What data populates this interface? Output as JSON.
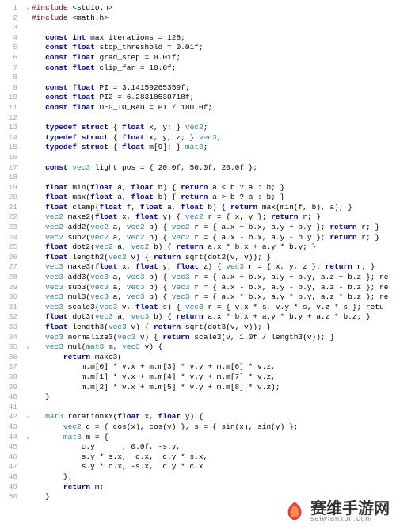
{
  "watermark": {
    "text": "赛维手游网",
    "sub": "saiwianxun.com"
  },
  "code": [
    {
      "n": 1,
      "fold": "v",
      "segs": [
        [
          "pp",
          "#include "
        ],
        [
          "nm",
          "<stdio.h>"
        ]
      ]
    },
    {
      "n": 2,
      "fold": "|",
      "segs": [
        [
          "pp",
          "#include "
        ],
        [
          "nm",
          "<math.h>"
        ]
      ]
    },
    {
      "n": 3,
      "fold": "",
      "segs": []
    },
    {
      "n": 4,
      "fold": "",
      "segs": [
        [
          "nm",
          "   "
        ],
        [
          "kw",
          "const int"
        ],
        [
          "nm",
          " max_iterations = 128;"
        ]
      ]
    },
    {
      "n": 5,
      "fold": "",
      "segs": [
        [
          "nm",
          "   "
        ],
        [
          "kw",
          "const float"
        ],
        [
          "nm",
          " stop_threshold = 0.01f;"
        ]
      ]
    },
    {
      "n": 6,
      "fold": "",
      "segs": [
        [
          "nm",
          "   "
        ],
        [
          "kw",
          "const float"
        ],
        [
          "nm",
          " grad_step = 0.01f;"
        ]
      ]
    },
    {
      "n": 7,
      "fold": "",
      "segs": [
        [
          "nm",
          "   "
        ],
        [
          "kw",
          "const float"
        ],
        [
          "nm",
          " clip_far = 10.0f;"
        ]
      ]
    },
    {
      "n": 8,
      "fold": "",
      "segs": []
    },
    {
      "n": 9,
      "fold": "",
      "segs": [
        [
          "nm",
          "   "
        ],
        [
          "kw",
          "const float"
        ],
        [
          "nm",
          " PI = 3.14159265359f;"
        ]
      ]
    },
    {
      "n": 10,
      "fold": "",
      "segs": [
        [
          "nm",
          "   "
        ],
        [
          "kw",
          "const float"
        ],
        [
          "nm",
          " PI2 = 6.28318530718f;"
        ]
      ]
    },
    {
      "n": 11,
      "fold": "",
      "segs": [
        [
          "nm",
          "   "
        ],
        [
          "kw",
          "const float"
        ],
        [
          "nm",
          " DEG_TO_RAD = PI / 180.0f;"
        ]
      ]
    },
    {
      "n": 12,
      "fold": "",
      "segs": []
    },
    {
      "n": 13,
      "fold": "",
      "segs": [
        [
          "nm",
          "   "
        ],
        [
          "kw",
          "typedef struct"
        ],
        [
          "nm",
          " { "
        ],
        [
          "kw",
          "float"
        ],
        [
          "nm",
          " x, y; } "
        ],
        [
          "ty",
          "vec2"
        ],
        [
          "nm",
          ";"
        ]
      ]
    },
    {
      "n": 14,
      "fold": "",
      "segs": [
        [
          "nm",
          "   "
        ],
        [
          "kw",
          "typedef struct"
        ],
        [
          "nm",
          " { "
        ],
        [
          "kw",
          "float"
        ],
        [
          "nm",
          " x, y, z; } "
        ],
        [
          "ty",
          "vec3"
        ],
        [
          "nm",
          ";"
        ]
      ]
    },
    {
      "n": 15,
      "fold": "",
      "segs": [
        [
          "nm",
          "   "
        ],
        [
          "kw",
          "typedef struct"
        ],
        [
          "nm",
          " { "
        ],
        [
          "kw",
          "float"
        ],
        [
          "nm",
          " m[9]; } "
        ],
        [
          "ty",
          "mat3"
        ],
        [
          "nm",
          ";"
        ]
      ]
    },
    {
      "n": 16,
      "fold": "",
      "segs": []
    },
    {
      "n": 17,
      "fold": "",
      "segs": [
        [
          "nm",
          "   "
        ],
        [
          "kw",
          "const"
        ],
        [
          "nm",
          " "
        ],
        [
          "ty",
          "vec3"
        ],
        [
          "nm",
          " light_pos = { 20.0f, 50.0f, 20.0f };"
        ]
      ]
    },
    {
      "n": 18,
      "fold": "",
      "segs": []
    },
    {
      "n": 19,
      "fold": "",
      "segs": [
        [
          "nm",
          "   "
        ],
        [
          "kw",
          "float"
        ],
        [
          "nm",
          " min("
        ],
        [
          "kw",
          "float"
        ],
        [
          "nm",
          " a, "
        ],
        [
          "kw",
          "float"
        ],
        [
          "nm",
          " b) { "
        ],
        [
          "kw",
          "return"
        ],
        [
          "nm",
          " a < b ? a : b; }"
        ]
      ]
    },
    {
      "n": 20,
      "fold": "",
      "segs": [
        [
          "nm",
          "   "
        ],
        [
          "kw",
          "float"
        ],
        [
          "nm",
          " max("
        ],
        [
          "kw",
          "float"
        ],
        [
          "nm",
          " a, "
        ],
        [
          "kw",
          "float"
        ],
        [
          "nm",
          " b) { "
        ],
        [
          "kw",
          "return"
        ],
        [
          "nm",
          " a > b ? a : b; }"
        ]
      ]
    },
    {
      "n": 21,
      "fold": "",
      "segs": [
        [
          "nm",
          "   "
        ],
        [
          "kw",
          "float"
        ],
        [
          "nm",
          " clamp("
        ],
        [
          "kw",
          "float"
        ],
        [
          "nm",
          " f, "
        ],
        [
          "kw",
          "float"
        ],
        [
          "nm",
          " a, "
        ],
        [
          "kw",
          "float"
        ],
        [
          "nm",
          " b) { "
        ],
        [
          "kw",
          "return"
        ],
        [
          "nm",
          " max(min(f, b), a); }"
        ]
      ]
    },
    {
      "n": 22,
      "fold": "",
      "segs": [
        [
          "nm",
          "   "
        ],
        [
          "ty",
          "vec2"
        ],
        [
          "nm",
          " make2("
        ],
        [
          "kw",
          "float"
        ],
        [
          "nm",
          " x, "
        ],
        [
          "kw",
          "float"
        ],
        [
          "nm",
          " y) { "
        ],
        [
          "ty",
          "vec2"
        ],
        [
          "nm",
          " r = { x, y }; "
        ],
        [
          "kw",
          "return"
        ],
        [
          "nm",
          " r; }"
        ]
      ]
    },
    {
      "n": 23,
      "fold": "",
      "segs": [
        [
          "nm",
          "   "
        ],
        [
          "ty",
          "vec2"
        ],
        [
          "nm",
          " add2("
        ],
        [
          "ty",
          "vec2"
        ],
        [
          "nm",
          " a, "
        ],
        [
          "ty",
          "vec2"
        ],
        [
          "nm",
          " b) { "
        ],
        [
          "ty",
          "vec2"
        ],
        [
          "nm",
          " r = { a.x + b.x, a.y + b.y }; "
        ],
        [
          "kw",
          "return"
        ],
        [
          "nm",
          " r; }"
        ]
      ]
    },
    {
      "n": 24,
      "fold": "",
      "segs": [
        [
          "nm",
          "   "
        ],
        [
          "ty",
          "vec2"
        ],
        [
          "nm",
          " sub2("
        ],
        [
          "ty",
          "vec2"
        ],
        [
          "nm",
          " a, "
        ],
        [
          "ty",
          "vec2"
        ],
        [
          "nm",
          " b) { "
        ],
        [
          "ty",
          "vec2"
        ],
        [
          "nm",
          " r = { a.x - b.x, a.y - b.y }; "
        ],
        [
          "kw",
          "return"
        ],
        [
          "nm",
          " r; }"
        ]
      ]
    },
    {
      "n": 25,
      "fold": "",
      "segs": [
        [
          "nm",
          "   "
        ],
        [
          "kw",
          "float"
        ],
        [
          "nm",
          " dot2("
        ],
        [
          "ty",
          "vec2"
        ],
        [
          "nm",
          " a, "
        ],
        [
          "ty",
          "vec2"
        ],
        [
          "nm",
          " b) { "
        ],
        [
          "kw",
          "return"
        ],
        [
          "nm",
          " a.x * b.x + a.y * b.y; }"
        ]
      ]
    },
    {
      "n": 26,
      "fold": "",
      "segs": [
        [
          "nm",
          "   "
        ],
        [
          "kw",
          "float"
        ],
        [
          "nm",
          " length2("
        ],
        [
          "ty",
          "vec2"
        ],
        [
          "nm",
          " v) { "
        ],
        [
          "kw",
          "return"
        ],
        [
          "nm",
          " sqrt(dot2(v, v)); }"
        ]
      ]
    },
    {
      "n": 27,
      "fold": "",
      "segs": [
        [
          "nm",
          "   "
        ],
        [
          "ty",
          "vec3"
        ],
        [
          "nm",
          " make3("
        ],
        [
          "kw",
          "float"
        ],
        [
          "nm",
          " x, "
        ],
        [
          "kw",
          "float"
        ],
        [
          "nm",
          " y, "
        ],
        [
          "kw",
          "float"
        ],
        [
          "nm",
          " z) { "
        ],
        [
          "ty",
          "vec3"
        ],
        [
          "nm",
          " r = { x, y, z }; "
        ],
        [
          "kw",
          "return"
        ],
        [
          "nm",
          " r; }"
        ]
      ]
    },
    {
      "n": 28,
      "fold": "",
      "segs": [
        [
          "nm",
          "   "
        ],
        [
          "ty",
          "vec3"
        ],
        [
          "nm",
          " add3("
        ],
        [
          "ty",
          "vec3"
        ],
        [
          "nm",
          " a, "
        ],
        [
          "ty",
          "vec3"
        ],
        [
          "nm",
          " b) { "
        ],
        [
          "ty",
          "vec3"
        ],
        [
          "nm",
          " r = { a.x + b.x, a.y + b.y, a.z + b.z }; re"
        ]
      ]
    },
    {
      "n": 29,
      "fold": "",
      "segs": [
        [
          "nm",
          "   "
        ],
        [
          "ty",
          "vec3"
        ],
        [
          "nm",
          " sub3("
        ],
        [
          "ty",
          "vec3"
        ],
        [
          "nm",
          " a, "
        ],
        [
          "ty",
          "vec3"
        ],
        [
          "nm",
          " b) { "
        ],
        [
          "ty",
          "vec3"
        ],
        [
          "nm",
          " r = { a.x - b.x, a.y - b.y, a.z - b.z }; re"
        ]
      ]
    },
    {
      "n": 30,
      "fold": "",
      "segs": [
        [
          "nm",
          "   "
        ],
        [
          "ty",
          "vec3"
        ],
        [
          "nm",
          " mul3("
        ],
        [
          "ty",
          "vec3"
        ],
        [
          "nm",
          " a, "
        ],
        [
          "ty",
          "vec3"
        ],
        [
          "nm",
          " b) { "
        ],
        [
          "ty",
          "vec3"
        ],
        [
          "nm",
          " r = { a.x * b.x, a.y * b.y, a.z * b.z }; re"
        ]
      ]
    },
    {
      "n": 31,
      "fold": "",
      "segs": [
        [
          "nm",
          "   "
        ],
        [
          "ty",
          "vec3"
        ],
        [
          "nm",
          " scale3("
        ],
        [
          "ty",
          "vec3"
        ],
        [
          "nm",
          " v, "
        ],
        [
          "kw",
          "float"
        ],
        [
          "nm",
          " s) { "
        ],
        [
          "ty",
          "vec3"
        ],
        [
          "nm",
          " r = { v.x * s, v.y * s, v.z * s }; retu"
        ]
      ]
    },
    {
      "n": 32,
      "fold": "",
      "segs": [
        [
          "nm",
          "   "
        ],
        [
          "kw",
          "float"
        ],
        [
          "nm",
          " dot3("
        ],
        [
          "ty",
          "vec3"
        ],
        [
          "nm",
          " a, "
        ],
        [
          "ty",
          "vec3"
        ],
        [
          "nm",
          " b) { "
        ],
        [
          "kw",
          "return"
        ],
        [
          "nm",
          " a.x * b.x + a.y * b.y + a.z * b.z; }"
        ]
      ]
    },
    {
      "n": 33,
      "fold": "",
      "segs": [
        [
          "nm",
          "   "
        ],
        [
          "kw",
          "float"
        ],
        [
          "nm",
          " length3("
        ],
        [
          "ty",
          "vec3"
        ],
        [
          "nm",
          " v) { "
        ],
        [
          "kw",
          "return"
        ],
        [
          "nm",
          " sqrt(dot3(v, v)); }"
        ]
      ]
    },
    {
      "n": 34,
      "fold": "",
      "segs": [
        [
          "nm",
          "   "
        ],
        [
          "ty",
          "vec3"
        ],
        [
          "nm",
          " normalize3("
        ],
        [
          "ty",
          "vec3"
        ],
        [
          "nm",
          " v) { "
        ],
        [
          "kw",
          "return"
        ],
        [
          "nm",
          " scale3(v, 1.0f / length3(v)); }"
        ]
      ]
    },
    {
      "n": 35,
      "fold": "v",
      "segs": [
        [
          "nm",
          "   "
        ],
        [
          "ty",
          "vec3"
        ],
        [
          "nm",
          " mul("
        ],
        [
          "ty",
          "mat3"
        ],
        [
          "nm",
          " m, "
        ],
        [
          "ty",
          "vec3"
        ],
        [
          "nm",
          " v) {"
        ]
      ]
    },
    {
      "n": 36,
      "fold": "|",
      "segs": [
        [
          "nm",
          "       "
        ],
        [
          "kw",
          "return"
        ],
        [
          "nm",
          " make3("
        ]
      ]
    },
    {
      "n": 37,
      "fold": "|",
      "segs": [
        [
          "nm",
          "           m.m[0] * v.x + m.m[3] * v.y + m.m[6] * v.z,"
        ]
      ]
    },
    {
      "n": 38,
      "fold": "|",
      "segs": [
        [
          "nm",
          "           m.m[1] * v.x + m.m[4] * v.y + m.m[7] * v.z,"
        ]
      ]
    },
    {
      "n": 39,
      "fold": "|",
      "segs": [
        [
          "nm",
          "           m.m[2] * v.x + m.m[5] * v.y + m.m[8] * v.z);"
        ]
      ]
    },
    {
      "n": 40,
      "fold": "|",
      "segs": [
        [
          "nm",
          "   }"
        ]
      ]
    },
    {
      "n": 41,
      "fold": "",
      "segs": []
    },
    {
      "n": 42,
      "fold": "v",
      "segs": [
        [
          "nm",
          "   "
        ],
        [
          "ty",
          "mat3"
        ],
        [
          "nm",
          " rotationXY("
        ],
        [
          "kw",
          "float"
        ],
        [
          "nm",
          " x, "
        ],
        [
          "kw",
          "float"
        ],
        [
          "nm",
          " y) {"
        ]
      ]
    },
    {
      "n": 43,
      "fold": "|",
      "segs": [
        [
          "nm",
          "       "
        ],
        [
          "ty",
          "vec2"
        ],
        [
          "nm",
          " c = { cos(x), cos(y) }, s = { sin(x), sin(y) };"
        ]
      ]
    },
    {
      "n": 44,
      "fold": "v",
      "segs": [
        [
          "nm",
          "       "
        ],
        [
          "ty",
          "mat3"
        ],
        [
          "nm",
          " m = {"
        ]
      ]
    },
    {
      "n": 45,
      "fold": "|",
      "segs": [
        [
          "nm",
          "           c.y      , 0.0f, -s.y,"
        ]
      ]
    },
    {
      "n": 46,
      "fold": "|",
      "segs": [
        [
          "nm",
          "           s.y * s.x,  c.x,  c.y * s.x,"
        ]
      ]
    },
    {
      "n": 47,
      "fold": "|",
      "segs": [
        [
          "nm",
          "           s.y * c.x, -s.x,  c.y * c.x"
        ]
      ]
    },
    {
      "n": 48,
      "fold": "|",
      "segs": [
        [
          "nm",
          "       };"
        ]
      ]
    },
    {
      "n": 49,
      "fold": "|",
      "segs": [
        [
          "nm",
          "       "
        ],
        [
          "kw",
          "return"
        ],
        [
          "nm",
          " m;"
        ]
      ]
    },
    {
      "n": 50,
      "fold": "|",
      "segs": [
        [
          "nm",
          "   }"
        ]
      ]
    }
  ]
}
